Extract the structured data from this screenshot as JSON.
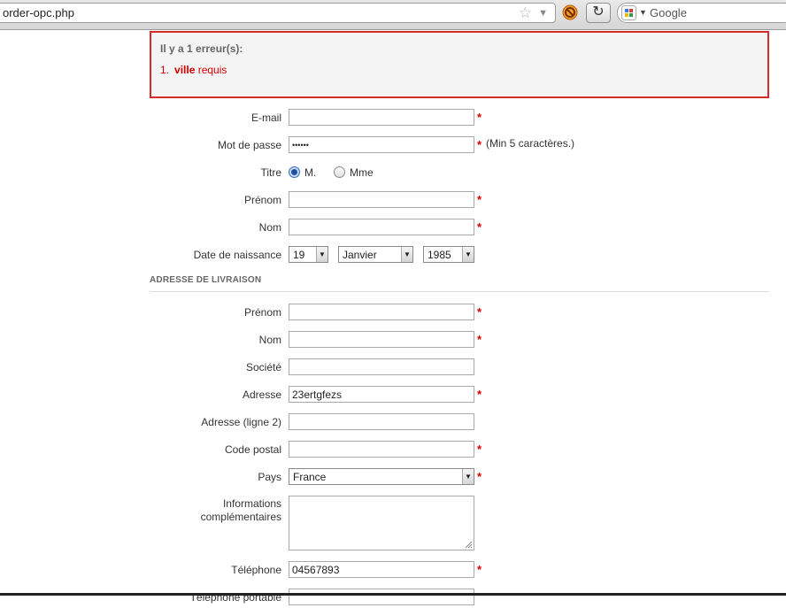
{
  "browser": {
    "url": "order-opc.php",
    "search_placeholder": "Google"
  },
  "errors": {
    "title": "Il y a 1 erreur(s):",
    "items": [
      {
        "number": "1.",
        "field": "ville",
        "message": " requis"
      }
    ]
  },
  "account": {
    "email_label": "E-mail",
    "email_value": "",
    "password_label": "Mot de passe",
    "password_value": "••••••",
    "password_hint": "(Min 5 caractères.)",
    "title_label": "Titre",
    "title_options": [
      "M.",
      "Mme"
    ],
    "title_selected": "M.",
    "firstname_label": "Prénom",
    "firstname_value": "",
    "lastname_label": "Nom",
    "lastname_value": "",
    "birthdate_label": "Date de naissance",
    "birth_day": "19",
    "birth_month": "Janvier",
    "birth_year": "1985"
  },
  "delivery": {
    "section_title": "ADRESSE DE LIVRAISON",
    "firstname_label": "Prénom",
    "firstname_value": "",
    "lastname_label": "Nom",
    "lastname_value": "",
    "company_label": "Société",
    "company_value": "",
    "address_label": "Adresse",
    "address_value": "23ertgfezs",
    "address2_label": "Adresse (ligne 2)",
    "address2_value": "",
    "postcode_label": "Code postal",
    "postcode_value": "",
    "country_label": "Pays",
    "country_value": "France",
    "other_label_line1": "Informations",
    "other_label_line2": "complémentaires",
    "phone_label": "Téléphone",
    "phone_value": "04567893",
    "mobile_label": "Téléphone portable"
  },
  "required_mark": "*",
  "colors": {
    "error_border": "#d42a2a",
    "required": "#d40000"
  }
}
